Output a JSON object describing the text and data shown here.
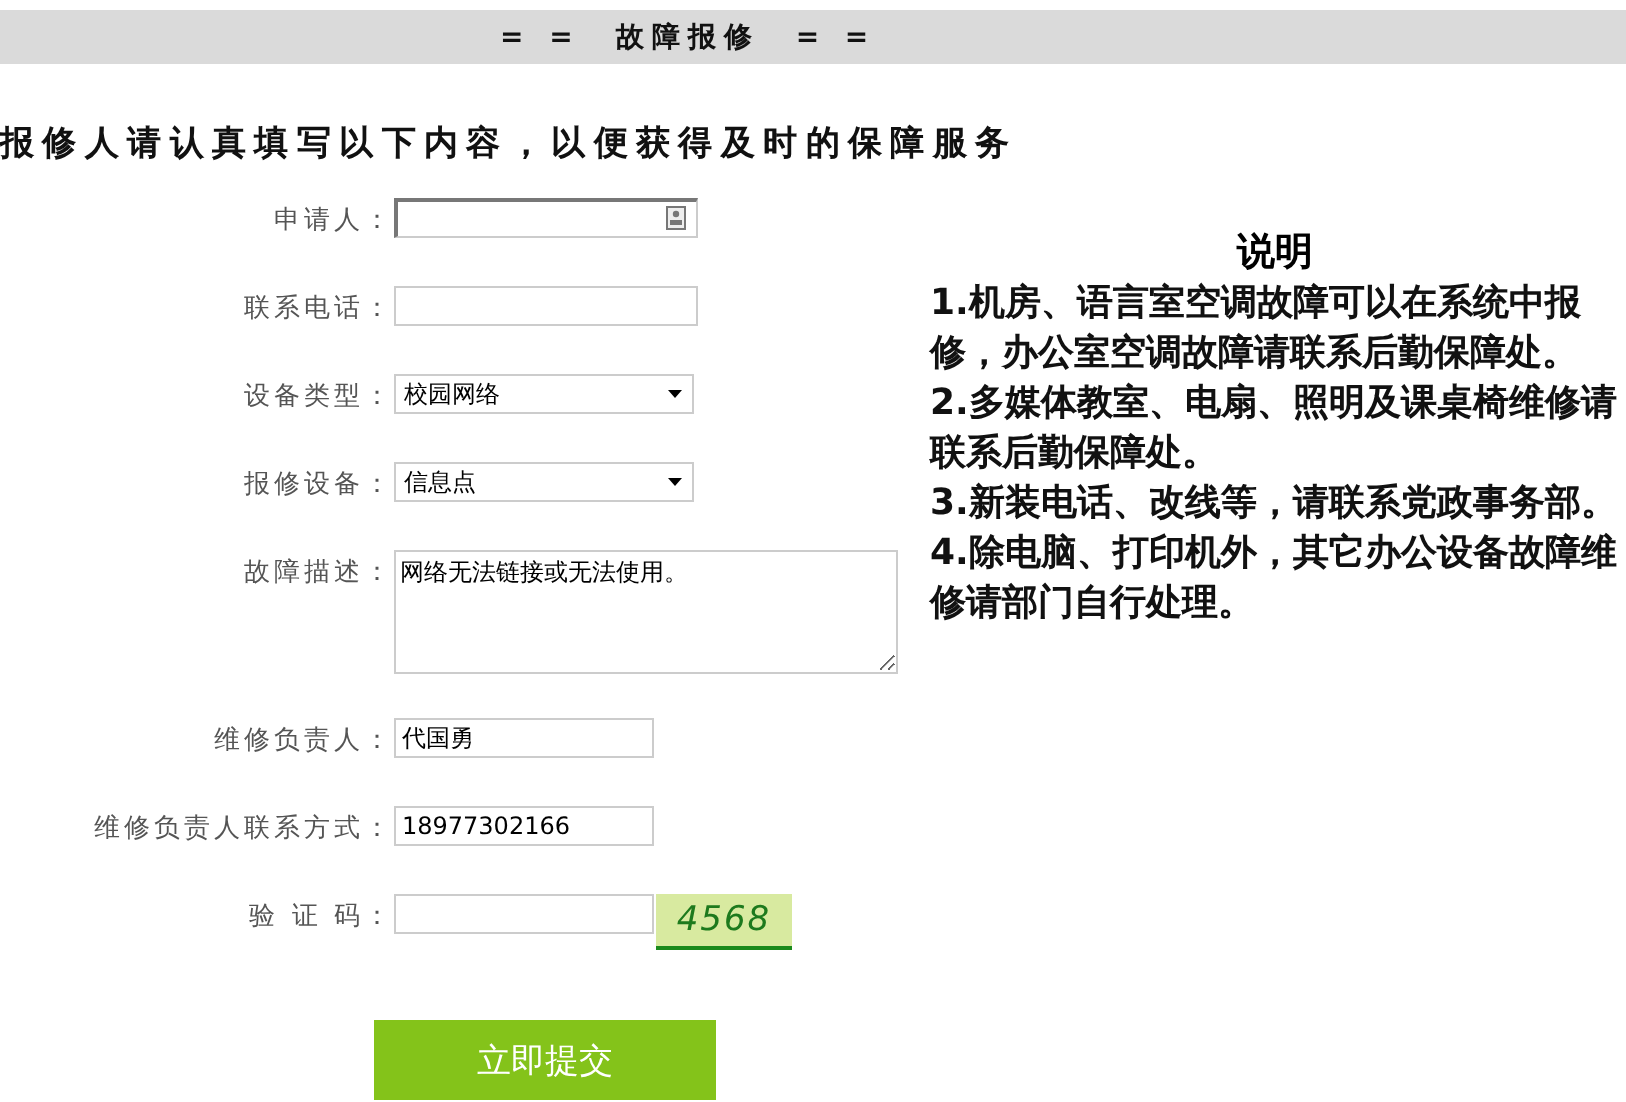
{
  "header": {
    "title": "= =  故障报修  = ="
  },
  "intro": "报修人请认真填写以下内容，以便获得及时的保障服务",
  "form": {
    "fields": [
      {
        "kind": "text",
        "label": "申请人：",
        "contact_icon": true
      },
      {
        "kind": "text",
        "label": "联系电话："
      },
      {
        "kind": "select",
        "label": "设备类型：",
        "value": "校园网络"
      },
      {
        "kind": "select",
        "label": "报修设备：",
        "value": "信息点"
      },
      {
        "kind": "textarea",
        "label": "故障描述：",
        "value": "网络无法链接或无法使用。"
      },
      {
        "kind": "short",
        "label": "维修负责人：",
        "value": "代国勇"
      },
      {
        "kind": "short",
        "label": "维修负责人联系方式：",
        "value": "18977302166"
      },
      {
        "kind": "captcha",
        "label": "验 证 码：",
        "code": "4568"
      }
    ],
    "submit": "立即提交"
  },
  "notes": {
    "title": "说明",
    "items": [
      "1.机房、语言室空调故障可以在系统中报修，办公室空调故障请联系后勤保障处。",
      "2.多媒体教室、电扇、照明及课桌椅维修请联系后勤保障处。",
      "3.新装电话、改线等，请联系党政事务部。",
      "4.除电脑、打印机外，其它办公设备故障维修请部门自行处理。"
    ]
  }
}
